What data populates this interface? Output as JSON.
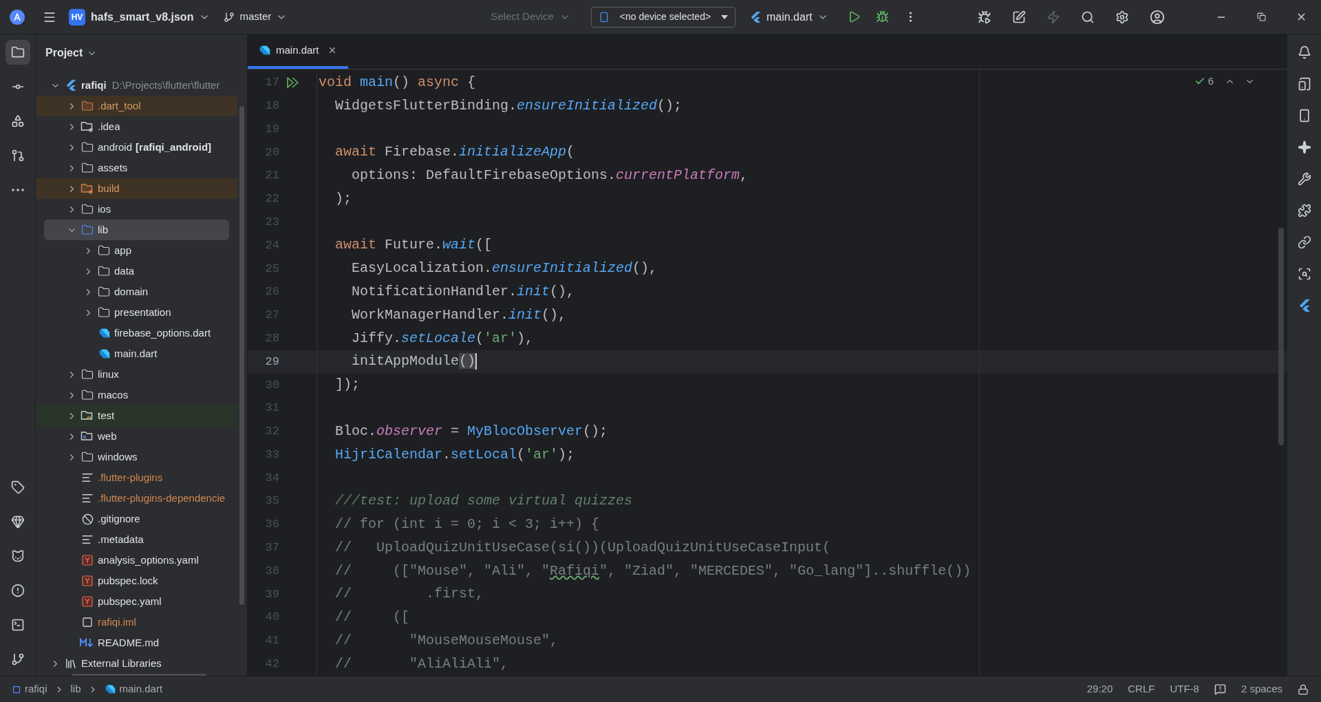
{
  "toolbar": {
    "project_badge": "HV",
    "project": "hafs_smart_v8.json",
    "branch": "master",
    "device_menu": {
      "label": "Select Device",
      "disabled": true
    },
    "device_selector": "<no device selected>",
    "run_config": "main.dart",
    "actions": [
      {
        "kind": "attach",
        "disabled": false
      },
      {
        "kind": "device-edit",
        "disabled": false
      },
      {
        "kind": "hot-reload",
        "disabled": true
      }
    ]
  },
  "left_rail": [
    {
      "selected": true
    },
    {
      "selected": false
    },
    {
      "selected": false
    },
    {
      "selected": false
    },
    {
      "selected": false
    }
  ],
  "project_panel": {
    "title": "Project",
    "tree": [
      {
        "name": "rafiqi",
        "kind": "flutter",
        "path": "D:\\Projects\\flutter\\flutter",
        "expanded": true,
        "selected": false,
        "children": [
          {
            "name": ".dart_tool",
            "kind": "excluded-folder",
            "expanded": false,
            "selected": false
          },
          {
            "name": ".idea",
            "kind": "config-folder",
            "expanded": false,
            "selected": false
          },
          {
            "name": "android",
            "module": "[rafiqi_android]",
            "kind": "folder",
            "expanded": false,
            "selected": false
          },
          {
            "name": "assets",
            "kind": "folder",
            "expanded": false,
            "selected": false
          },
          {
            "name": "build",
            "kind": "excluded-config-folder",
            "expanded": false,
            "selected": false
          },
          {
            "name": "ios",
            "kind": "folder",
            "expanded": false,
            "selected": false
          },
          {
            "name": "lib",
            "kind": "folder",
            "expanded": true,
            "selected": true,
            "children": [
              {
                "name": "app",
                "kind": "folder",
                "expanded": false,
                "selected": false
              },
              {
                "name": "data",
                "kind": "folder",
                "expanded": false,
                "selected": false
              },
              {
                "name": "domain",
                "kind": "folder",
                "expanded": false,
                "selected": false
              },
              {
                "name": "presentation",
                "kind": "folder",
                "expanded": false,
                "selected": false
              },
              {
                "name": "firebase_options.dart",
                "kind": "dart",
                "selected": false
              },
              {
                "name": "main.dart",
                "kind": "dart",
                "selected": false
              }
            ]
          },
          {
            "name": "linux",
            "kind": "folder",
            "expanded": false,
            "selected": false
          },
          {
            "name": "macos",
            "kind": "folder",
            "expanded": false,
            "selected": false
          },
          {
            "name": "test",
            "kind": "test-folder",
            "expanded": false,
            "selected": false
          },
          {
            "name": "web",
            "kind": "web-folder",
            "expanded": false,
            "selected": false
          },
          {
            "name": "windows",
            "kind": "folder",
            "expanded": false,
            "selected": false
          },
          {
            "name": ".flutter-plugins",
            "kind": "ignored-text",
            "selected": false
          },
          {
            "name": ".flutter-plugins-dependencie",
            "kind": "ignored-text",
            "selected": false
          },
          {
            "name": ".gitignore",
            "kind": "ignore",
            "selected": false
          },
          {
            "name": ".metadata",
            "kind": "text",
            "selected": false
          },
          {
            "name": "analysis_options.yaml",
            "kind": "yaml",
            "selected": false
          },
          {
            "name": "pubspec.lock",
            "kind": "yaml",
            "selected": false
          },
          {
            "name": "pubspec.yaml",
            "kind": "yaml",
            "selected": false
          },
          {
            "name": "rafiqi.iml",
            "kind": "ignored-module",
            "selected": false
          },
          {
            "name": "README.md",
            "kind": "markdown",
            "selected": false
          }
        ]
      },
      {
        "name": "External Libraries",
        "kind": "library",
        "expanded": false,
        "selected": false
      }
    ]
  },
  "tabs": [
    {
      "label": "main.dart",
      "selected": true
    }
  ],
  "editor": {
    "inspections": "6",
    "lines": [
      {
        "number": "17",
        "run": true,
        "current": false,
        "tokens": [
          {
            "kind": "kw",
            "text": "void "
          },
          {
            "kind": "fn",
            "text": "main"
          },
          {
            "kind": "plain",
            "text": "() "
          },
          {
            "kind": "kw",
            "text": "async "
          },
          {
            "kind": "plain",
            "text": "{"
          }
        ]
      },
      {
        "number": "18",
        "run": false,
        "current": false,
        "tokens": [
          {
            "kind": "plain",
            "text": "  WidgetsFlutterBinding."
          },
          {
            "kind": "call",
            "text": "ensureInitialized"
          },
          {
            "kind": "plain",
            "text": "();"
          }
        ]
      },
      {
        "number": "19",
        "run": false,
        "current": false
      },
      {
        "number": "20",
        "run": false,
        "current": false,
        "tokens": [
          {
            "kind": "kw",
            "text": "  await "
          },
          {
            "kind": "plain",
            "text": "Firebase."
          },
          {
            "kind": "call",
            "text": "initializeApp"
          },
          {
            "kind": "plain",
            "text": "("
          }
        ]
      },
      {
        "number": "21",
        "run": false,
        "current": false,
        "tokens": [
          {
            "kind": "plain",
            "text": "    options: DefaultFirebaseOptions."
          },
          {
            "kind": "field",
            "text": "currentPlatform"
          },
          {
            "kind": "plain",
            "text": ","
          }
        ]
      },
      {
        "number": "22",
        "run": false,
        "current": false,
        "tokens": [
          {
            "kind": "plain",
            "text": "  );"
          }
        ]
      },
      {
        "number": "23",
        "run": false,
        "current": false
      },
      {
        "number": "24",
        "run": false,
        "current": false,
        "tokens": [
          {
            "kind": "kw",
            "text": "  await "
          },
          {
            "kind": "plain",
            "text": "Future."
          },
          {
            "kind": "call",
            "text": "wait"
          },
          {
            "kind": "plain",
            "text": "(["
          }
        ]
      },
      {
        "number": "25",
        "run": false,
        "current": false,
        "tokens": [
          {
            "kind": "plain",
            "text": "    EasyLocalization."
          },
          {
            "kind": "call",
            "text": "ensureInitialized"
          },
          {
            "kind": "plain",
            "text": "(),"
          }
        ]
      },
      {
        "number": "26",
        "run": false,
        "current": false,
        "tokens": [
          {
            "kind": "plain",
            "text": "    NotificationHandler."
          },
          {
            "kind": "call",
            "text": "init"
          },
          {
            "kind": "plain",
            "text": "(),"
          }
        ]
      },
      {
        "number": "27",
        "run": false,
        "current": false,
        "tokens": [
          {
            "kind": "plain",
            "text": "    WorkManagerHandler."
          },
          {
            "kind": "call",
            "text": "init"
          },
          {
            "kind": "plain",
            "text": "(),"
          }
        ]
      },
      {
        "number": "28",
        "run": false,
        "current": false,
        "tokens": [
          {
            "kind": "plain",
            "text": "    Jiffy."
          },
          {
            "kind": "call",
            "text": "setLocale"
          },
          {
            "kind": "plain",
            "text": "("
          },
          {
            "kind": "str",
            "text": "'ar'"
          },
          {
            "kind": "plain",
            "text": "),"
          }
        ]
      },
      {
        "number": "29",
        "run": false,
        "current": true,
        "tokens": [
          {
            "kind": "plain",
            "text": "    initAppModule"
          },
          {
            "kind": "match",
            "text": "()"
          }
        ]
      },
      {
        "number": "30",
        "run": false,
        "current": false,
        "tokens": [
          {
            "kind": "plain",
            "text": "  ]);"
          }
        ]
      },
      {
        "number": "31",
        "run": false,
        "current": false
      },
      {
        "number": "32",
        "run": false,
        "current": false,
        "tokens": [
          {
            "kind": "plain",
            "text": "  Bloc."
          },
          {
            "kind": "field",
            "text": "observer"
          },
          {
            "kind": "plain",
            "text": " = "
          },
          {
            "kind": "type",
            "text": "MyBlocObserver"
          },
          {
            "kind": "plain",
            "text": "();"
          }
        ]
      },
      {
        "number": "33",
        "run": false,
        "current": false,
        "tokens": [
          {
            "kind": "type",
            "text": "  HijriCalendar"
          },
          {
            "kind": "plain",
            "text": "."
          },
          {
            "kind": "type",
            "text": "setLocal"
          },
          {
            "kind": "plain",
            "text": "("
          },
          {
            "kind": "str",
            "text": "'ar'"
          },
          {
            "kind": "plain",
            "text": ");"
          }
        ]
      },
      {
        "number": "34",
        "run": false,
        "current": false
      },
      {
        "number": "35",
        "run": false,
        "current": false,
        "tokens": [
          {
            "kind": "doc",
            "text": "  ///test: upload some virtual quizzes"
          }
        ]
      },
      {
        "number": "36",
        "run": false,
        "current": false,
        "tokens": [
          {
            "kind": "comment",
            "text": "  // for (int i = 0; i < 3; i++) {"
          }
        ]
      },
      {
        "number": "37",
        "run": false,
        "current": false,
        "tokens": [
          {
            "kind": "comment",
            "text": "  //   UploadQuizUnitUseCase(si())(UploadQuizUnitUseCaseInput("
          }
        ]
      },
      {
        "number": "38",
        "run": false,
        "current": false,
        "tokens": [
          {
            "kind": "comment",
            "text": "  //     ([\"Mouse\", \"Ali\", \""
          },
          {
            "kind": "typo",
            "text": "Rafiqi"
          },
          {
            "kind": "comment",
            "text": "\", \"Ziad\", \"MERCEDES\", \"Go_lang\"]..shuffle())"
          }
        ]
      },
      {
        "number": "39",
        "run": false,
        "current": false,
        "tokens": [
          {
            "kind": "comment",
            "text": "  //         .first,"
          }
        ]
      },
      {
        "number": "40",
        "run": false,
        "current": false,
        "tokens": [
          {
            "kind": "comment",
            "text": "  //     (["
          }
        ]
      },
      {
        "number": "41",
        "run": false,
        "current": false,
        "tokens": [
          {
            "kind": "comment",
            "text": "  //       \"MouseMouseMouse\","
          }
        ]
      },
      {
        "number": "42",
        "run": false,
        "current": false,
        "tokens": [
          {
            "kind": "comment",
            "text": "  //       \"AliAliAli\","
          }
        ]
      }
    ]
  },
  "status_bar": {
    "breadcrumbs": [
      {
        "text": "rafiqi",
        "kind": "module"
      },
      {
        "text": "lib",
        "kind": "folder"
      },
      {
        "text": "main.dart",
        "kind": "dart"
      }
    ],
    "position": "29:20",
    "line_separator": "CRLF",
    "encoding": "UTF-8",
    "indent": "2 spaces"
  }
}
